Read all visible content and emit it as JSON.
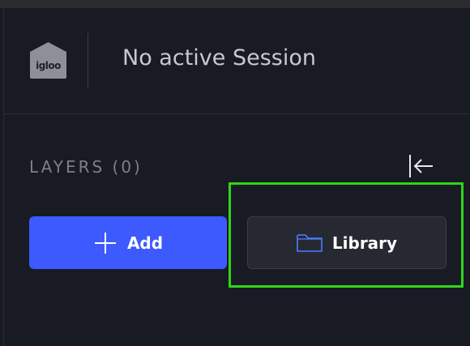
{
  "app": {
    "logo_text": "igloo",
    "session_title": "No active Session"
  },
  "layers": {
    "label": "LAYERS (0)",
    "add_label": "Add",
    "library_label": "Library"
  },
  "colors": {
    "accent": "#3d5afe",
    "highlight": "#2ed51a"
  },
  "icons": {
    "logo": "igloo-logo-icon",
    "collapse": "collapse-left-arrow-icon",
    "add": "plus-icon",
    "library": "folder-icon"
  }
}
